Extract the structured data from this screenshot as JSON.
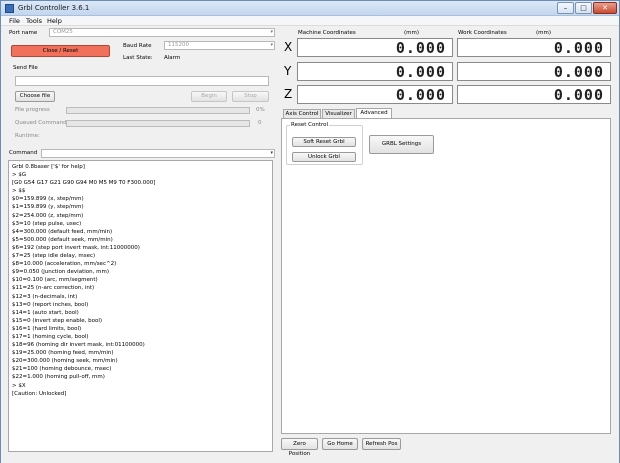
{
  "window": {
    "title": "Grbl Controller 3.6.1",
    "controls": [
      "–",
      "□",
      "✕"
    ]
  },
  "menu": [
    "File",
    "Tools",
    "Help"
  ],
  "connection": {
    "port_label": "Port name",
    "port_value": "COM25",
    "baud_label": "Baud Rate",
    "baud_value": "115200",
    "close_button": "Close / Reset",
    "last_state_label": "Last State:",
    "last_state_value": "Alarm"
  },
  "send_file": {
    "label": "Send File",
    "choose_button": "Choose file",
    "begin_button": "Begin",
    "stop_button": "Stop",
    "file_progress_label": "File progress",
    "file_progress_value": "0%",
    "file_progress_fraction": 0,
    "queued_label": "Queued Commands",
    "queued_value": "0",
    "runtime_label": "Runtime:"
  },
  "command": {
    "label": "Command",
    "console_lines": [
      "Grbl 0.8baser ['$' for help]",
      "> $G",
      "[G0 G54 G17 G21 G90 G94 M0 M5 M9 T0 F300.000]",
      "> $$",
      "$0=159.899 (x, step/mm)",
      "$1=159.899 (y, step/mm)",
      "$2=254.000 (z, step/mm)",
      "$3=10 (step pulse, usec)",
      "$4=300.000 (default feed, mm/min)",
      "$5=500.000 (default seek, mm/min)",
      "$6=192 (step port invert mask, int:11000000)",
      "$7=25 (step idle delay, msec)",
      "$8=10.000 (acceleration, mm/sec^2)",
      "$9=0.050 (junction deviation, mm)",
      "$10=0.100 (arc, mm/segment)",
      "$11=25 (n-arc correction, int)",
      "$12=3 (n-decimals, int)",
      "$13=0 (report inches, bool)",
      "$14=1 (auto start, bool)",
      "$15=0 (invert step enable, bool)",
      "$16=1 (hard limits, bool)",
      "$17=1 (homing cycle, bool)",
      "$18=96 (homing dir invert mask, int:01100000)",
      "$19=25.000 (homing feed, mm/min)",
      "$20=300.000 (homing seek, mm/min)",
      "$21=100 (homing debounce, msec)",
      "$22=1.000 (homing pull-off, mm)",
      "> $X",
      "[Caution: Unlocked]"
    ]
  },
  "coordinates": {
    "machine_label": "Machine Coordinates",
    "work_label": "Work Coordinates",
    "unit": "(mm)",
    "axes": [
      {
        "name": "X",
        "machine": "0.000",
        "work": "0.000"
      },
      {
        "name": "Y",
        "machine": "0.000",
        "work": "0.000"
      },
      {
        "name": "Z",
        "machine": "0.000",
        "work": "0.000"
      }
    ]
  },
  "tabs": [
    "Axis Control",
    "Visualizer",
    "Advanced"
  ],
  "advanced": {
    "group_title": "Reset Control",
    "soft_reset_button": "Soft Reset Grbl",
    "unlock_button": "Unlock Grbl",
    "settings_button": "GRBL Settings"
  },
  "bottom_buttons": [
    "Zero Position",
    "Go Home",
    "Refresh Pos"
  ]
}
